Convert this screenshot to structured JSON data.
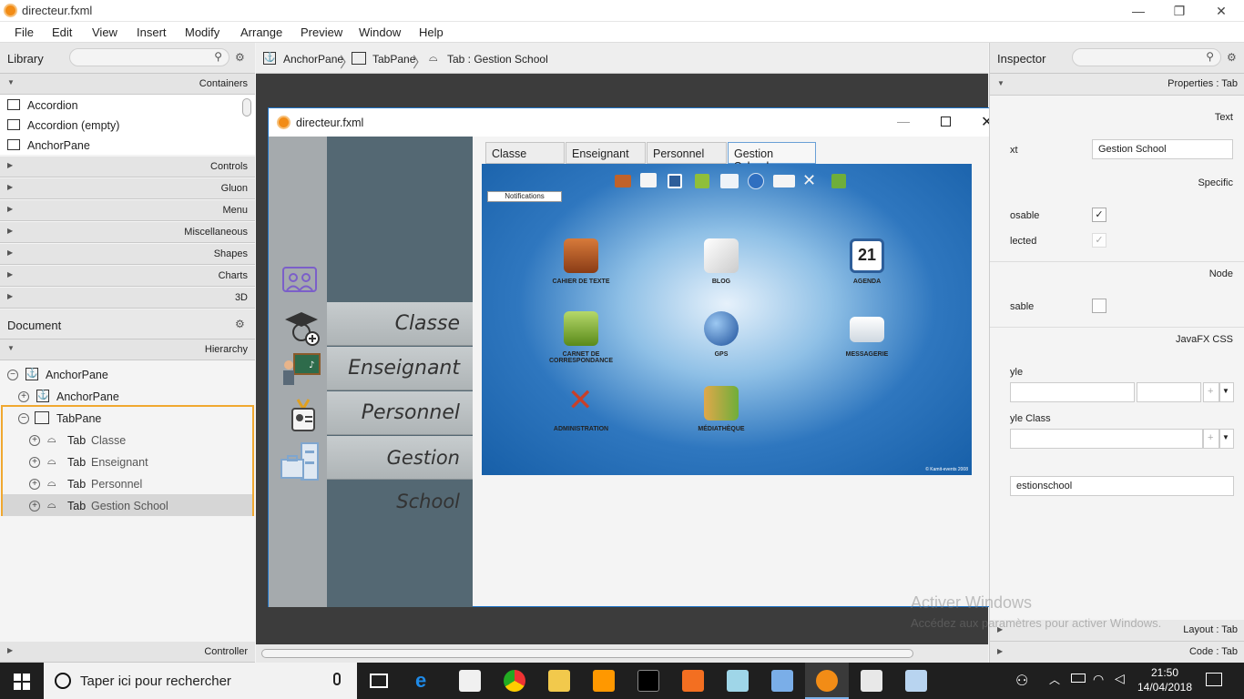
{
  "window": {
    "title": "directeur.fxml",
    "controls": [
      "—",
      "❐",
      "✕"
    ]
  },
  "menu": [
    "File",
    "Edit",
    "View",
    "Insert",
    "Modify",
    "Arrange",
    "Preview",
    "Window",
    "Help"
  ],
  "library": {
    "title": "Library",
    "sections_top": "Containers",
    "items": [
      "Accordion",
      "Accordion  (empty)",
      "AnchorPane"
    ],
    "sections": [
      "Controls",
      "Gluon",
      "Menu",
      "Miscellaneous",
      "Shapes",
      "Charts",
      "3D"
    ]
  },
  "document": {
    "title": "Document",
    "hierarchy_label": "Hierarchy",
    "tree": [
      {
        "label": "AnchorPane",
        "kind": ""
      },
      {
        "label": "AnchorPane",
        "kind": ""
      },
      {
        "label": "TabPane",
        "kind": ""
      },
      {
        "label": "Classe",
        "kind": "Tab"
      },
      {
        "label": "Enseignant",
        "kind": "Tab"
      },
      {
        "label": "Personnel",
        "kind": "Tab"
      },
      {
        "label": "Gestion School",
        "kind": "Tab"
      }
    ],
    "controller": "Controller"
  },
  "breadcrumb": [
    "AnchorPane",
    "TabPane",
    "Tab : Gestion School"
  ],
  "preview": {
    "title": "directeur.fxml",
    "nav": [
      "Classe",
      "Enseignant",
      "Personnel",
      "Gestion School"
    ],
    "tabs": [
      "Classe",
      "Enseignant",
      "Personnel",
      "Gestion School"
    ],
    "notifications": "Notifications",
    "apps": [
      {
        "label": "CAHIER DE TEXTE",
        "color": "#c0622a"
      },
      {
        "label": "BLOG",
        "color": "#f0f0f0"
      },
      {
        "label": "AGENDA",
        "color": "#2d5e9a"
      },
      {
        "label": "CARNET DE CORRESPONDANCE",
        "color": "#8fbf3a"
      },
      {
        "label": "GPS",
        "color": "#2f6fc0"
      },
      {
        "label": "MESSAGERIE",
        "color": "#e8eef4"
      },
      {
        "label": "ADMINISTRATION",
        "color": "#c7402a"
      },
      {
        "label": "MÉDIATHÈQUE",
        "color": "#6fae3a"
      }
    ],
    "copyright": "© Kamit-events 2008"
  },
  "inspector": {
    "title": "Inspector",
    "properties": "Properties : Tab",
    "text_section": "Text",
    "text_label": "xt",
    "text_value": "Gestion School",
    "specific": "Specific",
    "closable": "osable",
    "selected": "lected",
    "node": "Node",
    "disable": "sable",
    "css": "JavaFX CSS",
    "style": "yle",
    "style_class": "yle Class",
    "id_value": "estionschool",
    "layout": "Layout : Tab",
    "code": "Code : Tab"
  },
  "watermark": {
    "line1": "Activer Windows",
    "line2": "Accédez aux paramètres pour activer Windows."
  },
  "taskbar": {
    "search": "Taper ici pour rechercher",
    "time": "21:50",
    "date": "14/04/2018"
  }
}
